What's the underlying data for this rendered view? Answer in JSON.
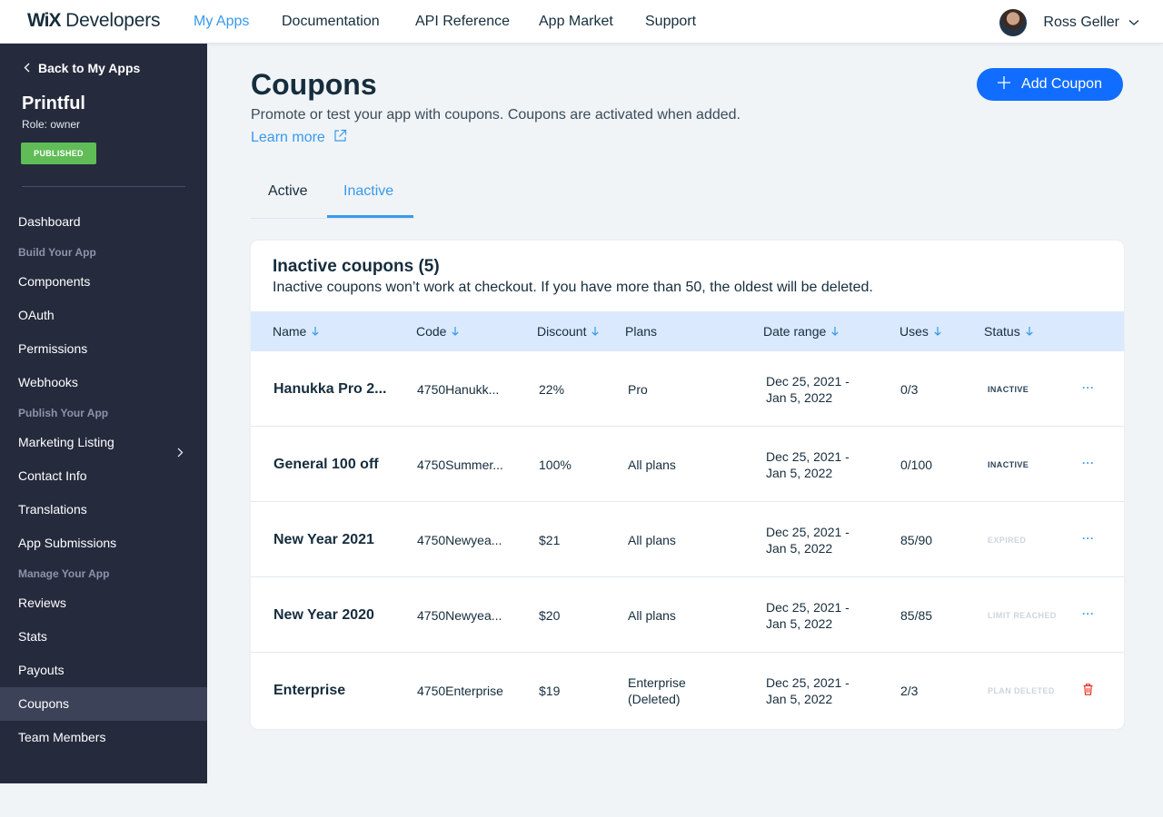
{
  "header": {
    "logo_brand": "WiX",
    "logo_product": "Developers",
    "nav": [
      "My Apps",
      "Documentation",
      "API Reference",
      "App Market",
      "Support"
    ],
    "active_nav": "My Apps",
    "user_name": "Ross Geller"
  },
  "sidebar": {
    "back_label": "Back to My Apps",
    "app_name": "Printful",
    "role": "Role: owner",
    "badge": "PUBLISHED",
    "items": {
      "dashboard": "Dashboard",
      "components": "Components",
      "oauth": "OAuth",
      "permissions": "Permissions",
      "webhooks": "Webhooks",
      "marketing_listing": "Marketing Listing",
      "contact_info": "Contact Info",
      "translations": "Translations",
      "app_submissions": "App Submissions",
      "reviews": "Reviews",
      "stats": "Stats",
      "payouts": "Payouts",
      "coupons": "Coupons",
      "team_members": "Team Members"
    },
    "sections": {
      "build": "Build Your App",
      "publish": "Publish Your App",
      "manage": "Manage Your App"
    },
    "active_item": "Coupons"
  },
  "page": {
    "title": "Coupons",
    "subtitle": "Promote or test your app with coupons. Coupons are activated when added.",
    "learn_more": "Learn more",
    "add_button": "Add Coupon"
  },
  "tabs": {
    "active": "Active",
    "inactive": "Inactive",
    "selected": "Inactive"
  },
  "table": {
    "title": "Inactive coupons (5)",
    "subtitle": "Inactive coupons won’t work at checkout. If you have more than 50, the oldest will be deleted.",
    "columns": {
      "name": "Name",
      "code": "Code",
      "discount": "Discount",
      "plans": "Plans",
      "date_range": "Date range",
      "uses": "Uses",
      "status": "Status"
    },
    "rows": [
      {
        "name": "Hanukka Pro 2...",
        "code": "4750Hanukk...",
        "discount": "22%",
        "plans": "Pro",
        "date1": "Dec 25, 2021 -",
        "date2": "Jan 5, 2022",
        "uses": "0/3",
        "status": "INACTIVE",
        "action": "···"
      },
      {
        "name": "General 100 off",
        "code": "4750Summer...",
        "discount": "100%",
        "plans": "All plans",
        "date1": "Dec 25, 2021 -",
        "date2": "Jan 5, 2022",
        "uses": "0/100",
        "status": "INACTIVE",
        "action": "···"
      },
      {
        "name": "New Year 2021",
        "code": "4750Newyea...",
        "discount": "$21",
        "plans": "All plans",
        "date1": "Dec 25, 2021 -",
        "date2": "Jan 5, 2022",
        "uses": "85/90",
        "status": "EXPIRED",
        "action": "···"
      },
      {
        "name": "New Year 2020",
        "code": "4750Newyea...",
        "discount": "$20",
        "plans": "All plans",
        "date1": "Dec 25, 2021 -",
        "date2": "Jan 5, 2022",
        "uses": "85/85",
        "status": "LIMIT REACHED",
        "action": "···"
      },
      {
        "name": "Enterprise",
        "code": "4750Enterprise",
        "discount": "$19",
        "plans": "Enterprise\n(Deleted)",
        "date1": "Dec 25, 2021 -",
        "date2": "Jan 5, 2022",
        "uses": "2/3",
        "status": "PLAN DELETED",
        "action": "trash"
      }
    ]
  },
  "colors": {
    "accent": "#3899ec",
    "button": "#116dff",
    "sidebar": "#252a3d",
    "published": "#60bc57",
    "table_header": "#dae9fd",
    "danger": "#e62214"
  }
}
